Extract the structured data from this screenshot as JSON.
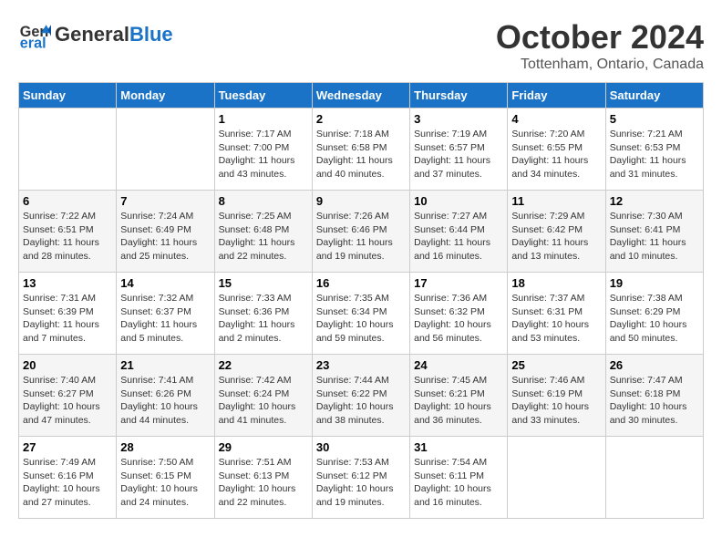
{
  "header": {
    "logo_line1": "General",
    "logo_line2": "Blue",
    "month": "October 2024",
    "location": "Tottenham, Ontario, Canada"
  },
  "days_of_week": [
    "Sunday",
    "Monday",
    "Tuesday",
    "Wednesday",
    "Thursday",
    "Friday",
    "Saturday"
  ],
  "weeks": [
    [
      {
        "day": "",
        "info": ""
      },
      {
        "day": "",
        "info": ""
      },
      {
        "day": "1",
        "info": "Sunrise: 7:17 AM\nSunset: 7:00 PM\nDaylight: 11 hours and 43 minutes."
      },
      {
        "day": "2",
        "info": "Sunrise: 7:18 AM\nSunset: 6:58 PM\nDaylight: 11 hours and 40 minutes."
      },
      {
        "day": "3",
        "info": "Sunrise: 7:19 AM\nSunset: 6:57 PM\nDaylight: 11 hours and 37 minutes."
      },
      {
        "day": "4",
        "info": "Sunrise: 7:20 AM\nSunset: 6:55 PM\nDaylight: 11 hours and 34 minutes."
      },
      {
        "day": "5",
        "info": "Sunrise: 7:21 AM\nSunset: 6:53 PM\nDaylight: 11 hours and 31 minutes."
      }
    ],
    [
      {
        "day": "6",
        "info": "Sunrise: 7:22 AM\nSunset: 6:51 PM\nDaylight: 11 hours and 28 minutes."
      },
      {
        "day": "7",
        "info": "Sunrise: 7:24 AM\nSunset: 6:49 PM\nDaylight: 11 hours and 25 minutes."
      },
      {
        "day": "8",
        "info": "Sunrise: 7:25 AM\nSunset: 6:48 PM\nDaylight: 11 hours and 22 minutes."
      },
      {
        "day": "9",
        "info": "Sunrise: 7:26 AM\nSunset: 6:46 PM\nDaylight: 11 hours and 19 minutes."
      },
      {
        "day": "10",
        "info": "Sunrise: 7:27 AM\nSunset: 6:44 PM\nDaylight: 11 hours and 16 minutes."
      },
      {
        "day": "11",
        "info": "Sunrise: 7:29 AM\nSunset: 6:42 PM\nDaylight: 11 hours and 13 minutes."
      },
      {
        "day": "12",
        "info": "Sunrise: 7:30 AM\nSunset: 6:41 PM\nDaylight: 11 hours and 10 minutes."
      }
    ],
    [
      {
        "day": "13",
        "info": "Sunrise: 7:31 AM\nSunset: 6:39 PM\nDaylight: 11 hours and 7 minutes."
      },
      {
        "day": "14",
        "info": "Sunrise: 7:32 AM\nSunset: 6:37 PM\nDaylight: 11 hours and 5 minutes."
      },
      {
        "day": "15",
        "info": "Sunrise: 7:33 AM\nSunset: 6:36 PM\nDaylight: 11 hours and 2 minutes."
      },
      {
        "day": "16",
        "info": "Sunrise: 7:35 AM\nSunset: 6:34 PM\nDaylight: 10 hours and 59 minutes."
      },
      {
        "day": "17",
        "info": "Sunrise: 7:36 AM\nSunset: 6:32 PM\nDaylight: 10 hours and 56 minutes."
      },
      {
        "day": "18",
        "info": "Sunrise: 7:37 AM\nSunset: 6:31 PM\nDaylight: 10 hours and 53 minutes."
      },
      {
        "day": "19",
        "info": "Sunrise: 7:38 AM\nSunset: 6:29 PM\nDaylight: 10 hours and 50 minutes."
      }
    ],
    [
      {
        "day": "20",
        "info": "Sunrise: 7:40 AM\nSunset: 6:27 PM\nDaylight: 10 hours and 47 minutes."
      },
      {
        "day": "21",
        "info": "Sunrise: 7:41 AM\nSunset: 6:26 PM\nDaylight: 10 hours and 44 minutes."
      },
      {
        "day": "22",
        "info": "Sunrise: 7:42 AM\nSunset: 6:24 PM\nDaylight: 10 hours and 41 minutes."
      },
      {
        "day": "23",
        "info": "Sunrise: 7:44 AM\nSunset: 6:22 PM\nDaylight: 10 hours and 38 minutes."
      },
      {
        "day": "24",
        "info": "Sunrise: 7:45 AM\nSunset: 6:21 PM\nDaylight: 10 hours and 36 minutes."
      },
      {
        "day": "25",
        "info": "Sunrise: 7:46 AM\nSunset: 6:19 PM\nDaylight: 10 hours and 33 minutes."
      },
      {
        "day": "26",
        "info": "Sunrise: 7:47 AM\nSunset: 6:18 PM\nDaylight: 10 hours and 30 minutes."
      }
    ],
    [
      {
        "day": "27",
        "info": "Sunrise: 7:49 AM\nSunset: 6:16 PM\nDaylight: 10 hours and 27 minutes."
      },
      {
        "day": "28",
        "info": "Sunrise: 7:50 AM\nSunset: 6:15 PM\nDaylight: 10 hours and 24 minutes."
      },
      {
        "day": "29",
        "info": "Sunrise: 7:51 AM\nSunset: 6:13 PM\nDaylight: 10 hours and 22 minutes."
      },
      {
        "day": "30",
        "info": "Sunrise: 7:53 AM\nSunset: 6:12 PM\nDaylight: 10 hours and 19 minutes."
      },
      {
        "day": "31",
        "info": "Sunrise: 7:54 AM\nSunset: 6:11 PM\nDaylight: 10 hours and 16 minutes."
      },
      {
        "day": "",
        "info": ""
      },
      {
        "day": "",
        "info": ""
      }
    ]
  ]
}
